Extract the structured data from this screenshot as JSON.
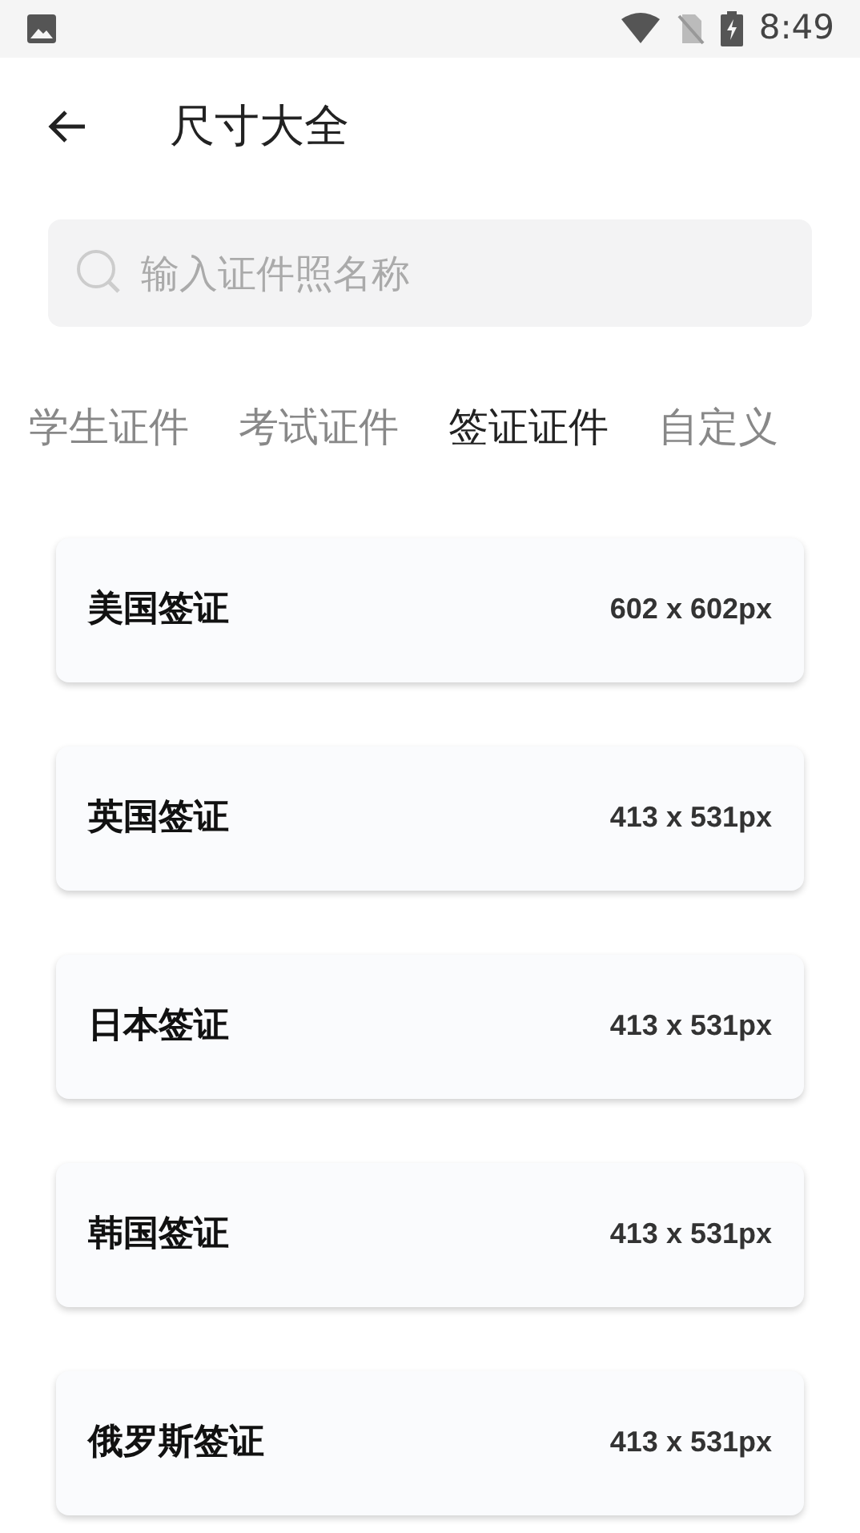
{
  "status_bar": {
    "time": "8:49"
  },
  "header": {
    "title": "尺寸大全"
  },
  "search": {
    "placeholder": "输入证件照名称"
  },
  "tabs": [
    {
      "label": "学生证件",
      "selected": false
    },
    {
      "label": "考试证件",
      "selected": false
    },
    {
      "label": "签证证件",
      "selected": true
    },
    {
      "label": "自定义",
      "selected": false
    }
  ],
  "items": [
    {
      "name": "美国签证",
      "size": "602 x 602px"
    },
    {
      "name": "英国签证",
      "size": "413 x 531px"
    },
    {
      "name": "日本签证",
      "size": "413 x 531px"
    },
    {
      "name": "韩国签证",
      "size": "413 x 531px"
    },
    {
      "name": "俄罗斯签证",
      "size": "413 x 531px"
    }
  ]
}
